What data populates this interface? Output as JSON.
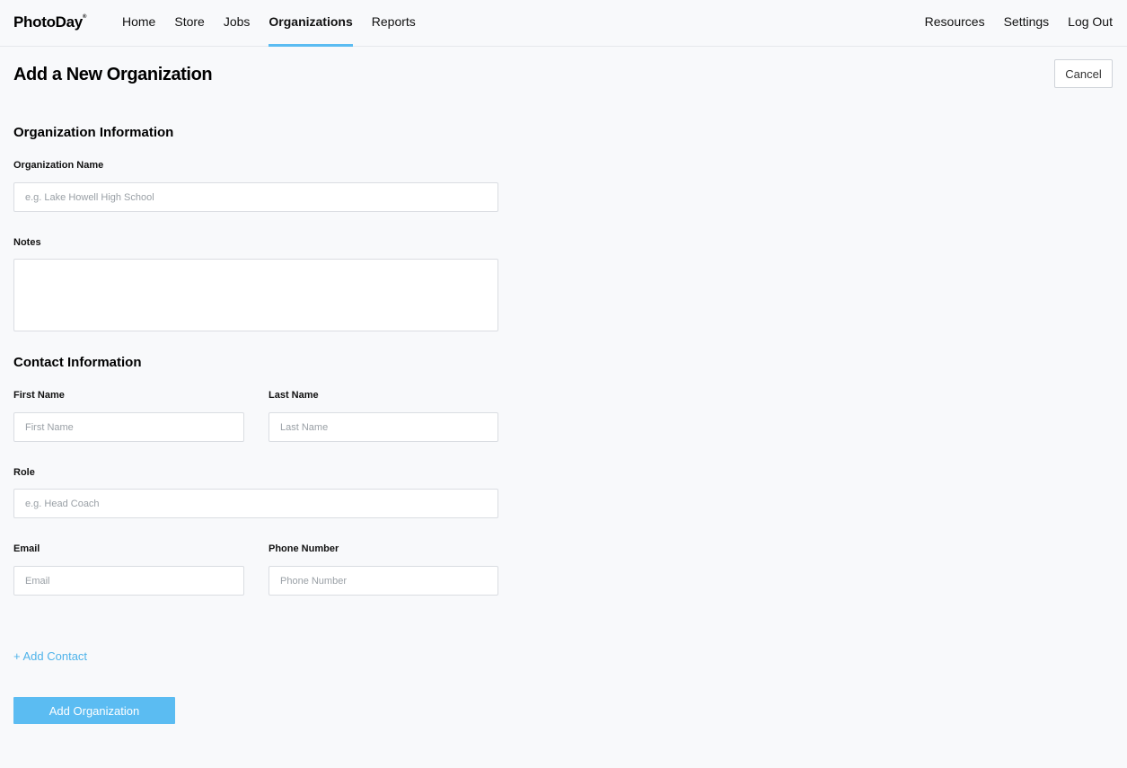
{
  "app": {
    "logo": "PhotoDay",
    "logo_mark": "®"
  },
  "nav": {
    "left": [
      "Home",
      "Store",
      "Jobs",
      "Organizations",
      "Reports"
    ],
    "active": "Organizations",
    "right": [
      "Resources",
      "Settings",
      "Log Out"
    ]
  },
  "page": {
    "title": "Add a New Organization",
    "cancel_label": "Cancel"
  },
  "org_info": {
    "section_title": "Organization Information",
    "name_label": "Organization Name",
    "name_placeholder": "e.g. Lake Howell High School",
    "notes_label": "Notes"
  },
  "contact_info": {
    "section_title": "Contact Information",
    "first_name_label": "First Name",
    "first_name_placeholder": "First Name",
    "last_name_label": "Last Name",
    "last_name_placeholder": "Last Name",
    "role_label": "Role",
    "role_placeholder": "e.g. Head Coach",
    "email_label": "Email",
    "email_placeholder": "Email",
    "phone_label": "Phone Number",
    "phone_placeholder": "Phone Number"
  },
  "actions": {
    "add_contact": "+ Add Contact",
    "submit": "Add Organization"
  },
  "colors": {
    "accent": "#5bbcf2",
    "link": "#4fb3ea",
    "background": "#f8f9fb"
  }
}
